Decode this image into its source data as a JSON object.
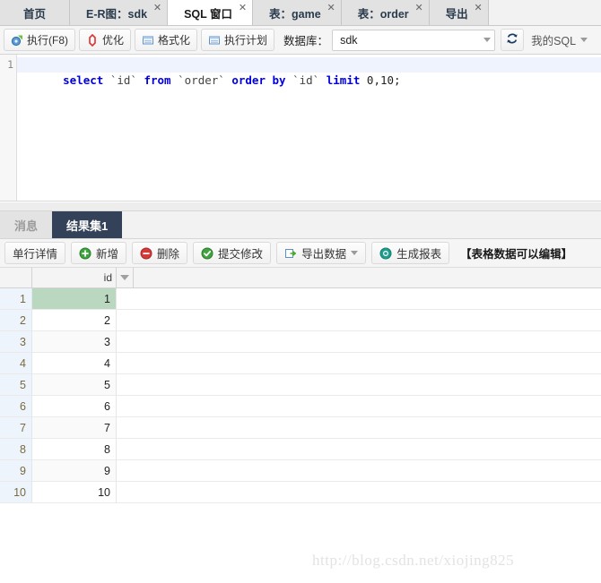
{
  "tabbar": {
    "tabs": [
      {
        "label": "首页",
        "closable": false,
        "active": false
      },
      {
        "label": "E-R图：sdk",
        "closable": true,
        "active": false
      },
      {
        "label": "SQL 窗口",
        "closable": true,
        "active": true
      },
      {
        "label": "表：game",
        "closable": true,
        "active": false
      },
      {
        "label": "表：order",
        "closable": true,
        "active": false
      },
      {
        "label": "导出",
        "closable": true,
        "active": false
      }
    ],
    "close_glyph": "✕"
  },
  "sql_toolbar": {
    "buttons": [
      {
        "label": "执行(F8)",
        "icon": "execute-icon"
      },
      {
        "label": "优化",
        "icon": "optimize-icon"
      },
      {
        "label": "格式化",
        "icon": "format-icon"
      },
      {
        "label": "执行计划",
        "icon": "explain-plan-icon"
      }
    ],
    "database_label": "数据库：",
    "database_value": "sdk",
    "refresh_icon": "refresh-icon",
    "mysql_menu_label": "我的SQL"
  },
  "editor": {
    "line_number": "1",
    "sql_tokens": [
      {
        "t": "select",
        "k": "kw"
      },
      {
        "t": " ",
        "k": "punct"
      },
      {
        "t": "`id`",
        "k": "ident"
      },
      {
        "t": " ",
        "k": "punct"
      },
      {
        "t": "from",
        "k": "kw"
      },
      {
        "t": " ",
        "k": "punct"
      },
      {
        "t": "`order`",
        "k": "ident"
      },
      {
        "t": " ",
        "k": "punct"
      },
      {
        "t": "order",
        "k": "kw"
      },
      {
        "t": " ",
        "k": "punct"
      },
      {
        "t": "by",
        "k": "kw"
      },
      {
        "t": " ",
        "k": "punct"
      },
      {
        "t": "`id`",
        "k": "ident"
      },
      {
        "t": " ",
        "k": "punct"
      },
      {
        "t": "limit",
        "k": "kw"
      },
      {
        "t": " ",
        "k": "punct"
      },
      {
        "t": "0,10;",
        "k": "num"
      }
    ],
    "sql_text": "select `id` from `order` order by `id` limit 0,10;"
  },
  "result_tabs": [
    {
      "label": "消息",
      "active": false
    },
    {
      "label": "结果集1",
      "active": true
    }
  ],
  "grid_toolbar": {
    "buttons": [
      {
        "label": "单行详情",
        "icon": "",
        "has_caret": false
      },
      {
        "label": "新增",
        "icon": "add-icon",
        "has_caret": false
      },
      {
        "label": "删除",
        "icon": "delete-icon",
        "has_caret": false
      },
      {
        "label": "提交修改",
        "icon": "commit-icon",
        "has_caret": false
      },
      {
        "label": "导出数据",
        "icon": "export-icon",
        "has_caret": true
      },
      {
        "label": "生成报表",
        "icon": "report-icon",
        "has_caret": false
      }
    ],
    "hint": "【表格数据可以编辑】"
  },
  "grid": {
    "columns": [
      "id"
    ],
    "filter_icon": "filter-caret-icon",
    "rows": [
      {
        "n": "1",
        "values": [
          "1"
        ],
        "selected": true
      },
      {
        "n": "2",
        "values": [
          "2"
        ],
        "selected": false
      },
      {
        "n": "3",
        "values": [
          "3"
        ],
        "selected": false
      },
      {
        "n": "4",
        "values": [
          "4"
        ],
        "selected": false
      },
      {
        "n": "5",
        "values": [
          "5"
        ],
        "selected": false
      },
      {
        "n": "6",
        "values": [
          "6"
        ],
        "selected": false
      },
      {
        "n": "7",
        "values": [
          "7"
        ],
        "selected": false
      },
      {
        "n": "8",
        "values": [
          "8"
        ],
        "selected": false
      },
      {
        "n": "9",
        "values": [
          "9"
        ],
        "selected": false
      },
      {
        "n": "10",
        "values": [
          "10"
        ],
        "selected": false
      }
    ]
  },
  "watermark": "http://blog.csdn.net/xiojing825",
  "colors": {
    "active_result_tab_bg": "#344259",
    "selected_row_bg": "#b9d8bf",
    "keyword": "#0000dd",
    "rownum_bg": "#eef4fb"
  }
}
